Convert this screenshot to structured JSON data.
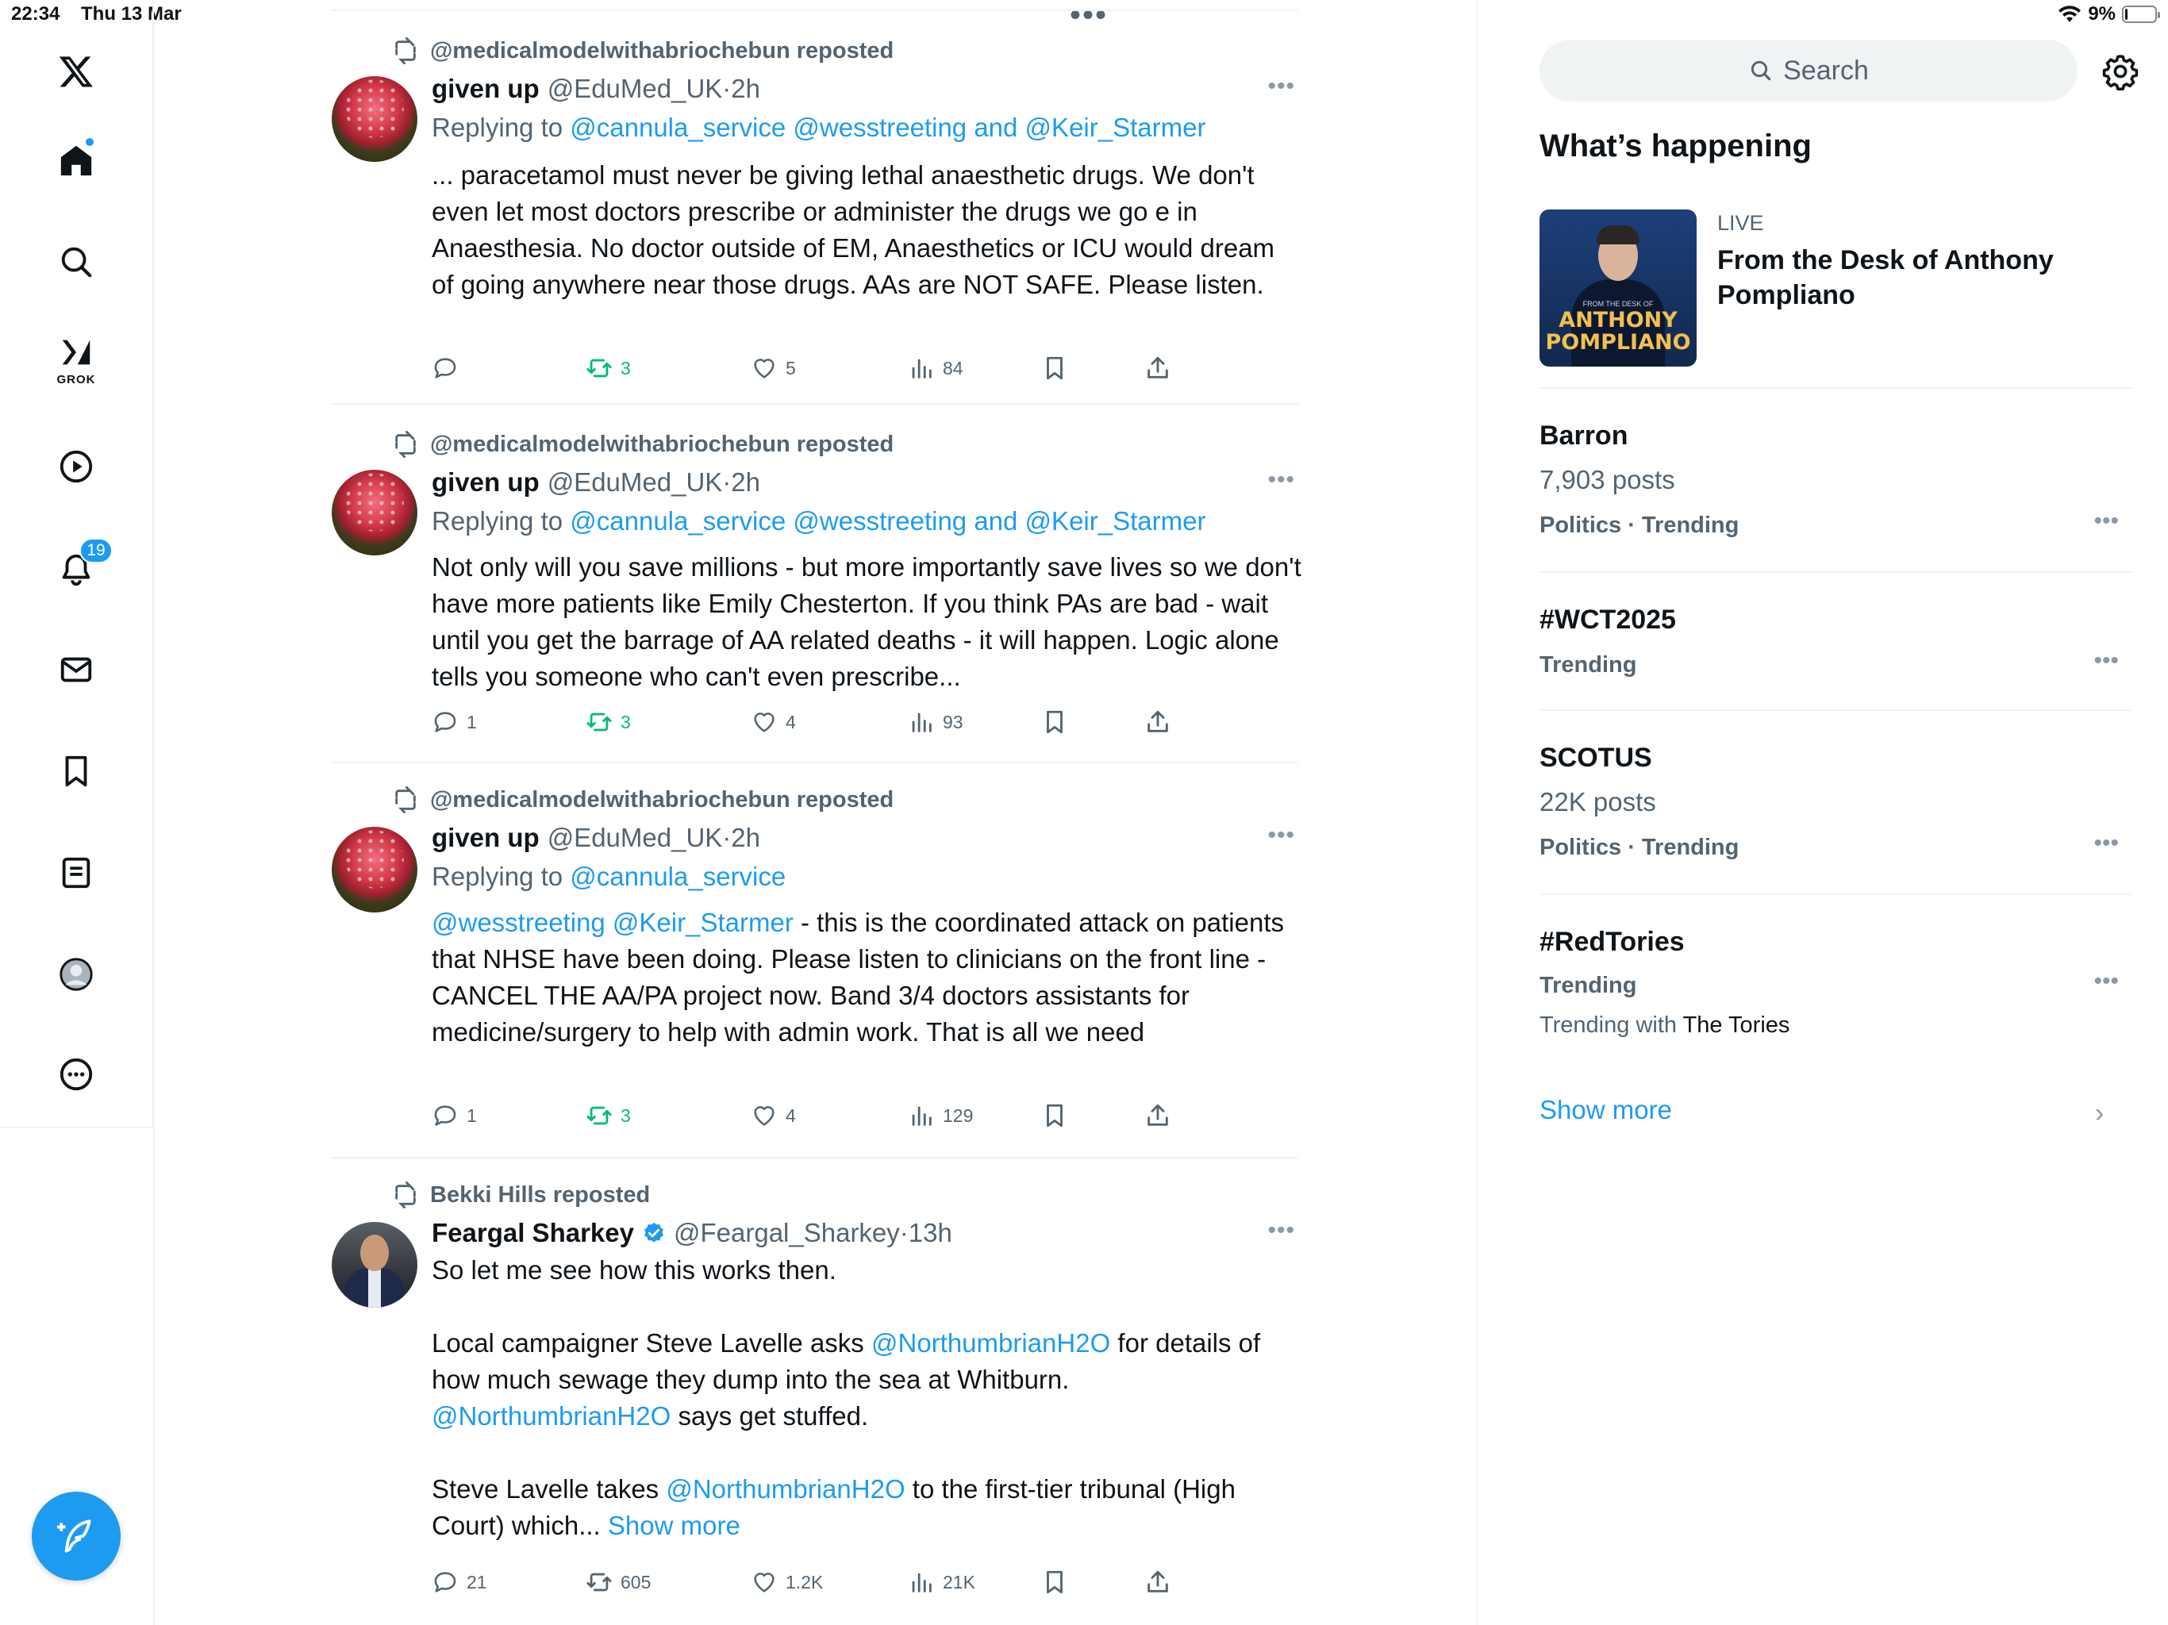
{
  "status_bar": {
    "time": "22:34",
    "date": "Thu 13 Mar",
    "battery": "9%",
    "battery_level": 0.09
  },
  "nav": {
    "items": [
      {
        "name": "home",
        "icon": "home-icon"
      },
      {
        "name": "explore",
        "icon": "search-icon"
      },
      {
        "name": "grok",
        "icon": "grok-icon",
        "label": "GROK"
      },
      {
        "name": "video",
        "icon": "play-icon"
      },
      {
        "name": "notifications",
        "icon": "bell-icon",
        "badge": "19"
      },
      {
        "name": "messages",
        "icon": "envelope-icon"
      },
      {
        "name": "bookmarks",
        "icon": "bookmark-icon"
      },
      {
        "name": "lists",
        "icon": "list-icon"
      },
      {
        "name": "profile",
        "icon": "profile-icon"
      },
      {
        "name": "more",
        "icon": "more-icon"
      }
    ]
  },
  "timeline": {
    "tweets": [
      {
        "context": "@medicalmodelwithabriochebun reposted",
        "name": "given up",
        "handle": "@EduMed_UK",
        "time": "·2h",
        "reply_prefix": "Replying to ",
        "reply_to": "@cannula_service @wesstreeting and @Keir_Starmer",
        "text": "... paracetamol must never be giving lethal anaesthetic drugs. We don't even let most doctors prescribe or administer the drugs we go e in Anaesthesia. No doctor outside of EM, Anaesthetics or ICU would dream of going anywhere near those drugs. AAs are NOT SAFE. Please listen.",
        "replies": "",
        "reposts": "3",
        "likes": "5",
        "views": "84"
      },
      {
        "context": "@medicalmodelwithabriochebun reposted",
        "name": "given up",
        "handle": "@EduMed_UK",
        "time": "·2h",
        "reply_prefix": "Replying to ",
        "reply_to": "@cannula_service @wesstreeting and @Keir_Starmer",
        "text": "Not only will you save millions - but more importantly save lives so we don't have more patients like Emily Chesterton. If you think PAs are bad - wait until you get the barrage of AA related deaths - it will happen. Logic alone tells you someone who can't even prescribe...",
        "replies": "1",
        "reposts": "3",
        "likes": "4",
        "views": "93"
      },
      {
        "context": "@medicalmodelwithabriochebun reposted",
        "name": "given up",
        "handle": "@EduMed_UK",
        "time": "·2h",
        "reply_prefix": "Replying to ",
        "reply_to": "@cannula_service",
        "text_mentions": "@wesstreeting @Keir_Starmer",
        "text": " - this is the coordinated attack on patients that NHSE have been doing. Please listen to clinicians on the front line - CANCEL THE AA/PA project now. Band 3/4 doctors assistants for medicine/surgery to help with admin work. That is all we need",
        "replies": "1",
        "reposts": "3",
        "likes": "4",
        "views": "129"
      },
      {
        "context": "Bekki Hills reposted",
        "name": "Feargal Sharkey",
        "handle": "@Feargal_Sharkey",
        "time": "·13h",
        "verified": true,
        "text_line1": "So let me see how this works then.",
        "p2_a": "Local campaigner Steve Lavelle asks ",
        "p2_m1": "@NorthumbrianH2O",
        "p2_b": " for details of how much sewage they dump into the sea at Whitburn.",
        "p3_m": "@NorthumbrianH2O",
        "p3_b": " says get stuffed.",
        "p4_a": "Steve Lavelle takes ",
        "p4_m": "@NorthumbrianH2O",
        "p4_b": " to the first-tier tribunal (High Court) which... ",
        "show_more": "Show more",
        "replies": "21",
        "reposts": "605",
        "likes": "1.2K",
        "views": "21K"
      }
    ]
  },
  "sidebar": {
    "search_placeholder": "Search",
    "title": "What’s happening",
    "live": {
      "label": "LIVE",
      "title": "From the Desk of Anthony Pompliano",
      "thumb_small": "FROM THE DESK OF",
      "thumb_text_1": "ANTHONY",
      "thumb_text_2": "POMPLIANO"
    },
    "trends": [
      {
        "name": "Barron",
        "posts": "7,903 posts",
        "meta": "Politics · Trending"
      },
      {
        "name": "#WCT2025",
        "meta": "Trending"
      },
      {
        "name": "SCOTUS",
        "posts": "22K posts",
        "meta": "Politics · Trending"
      },
      {
        "name": "#RedTories",
        "meta": "Trending",
        "with_prefix": "Trending with ",
        "with_topic": "The Tories"
      }
    ],
    "show_more": "Show more"
  },
  "colors": {
    "accent": "#1d9bf0",
    "repost_green": "#00ba7c",
    "secondary_text": "#536471"
  }
}
